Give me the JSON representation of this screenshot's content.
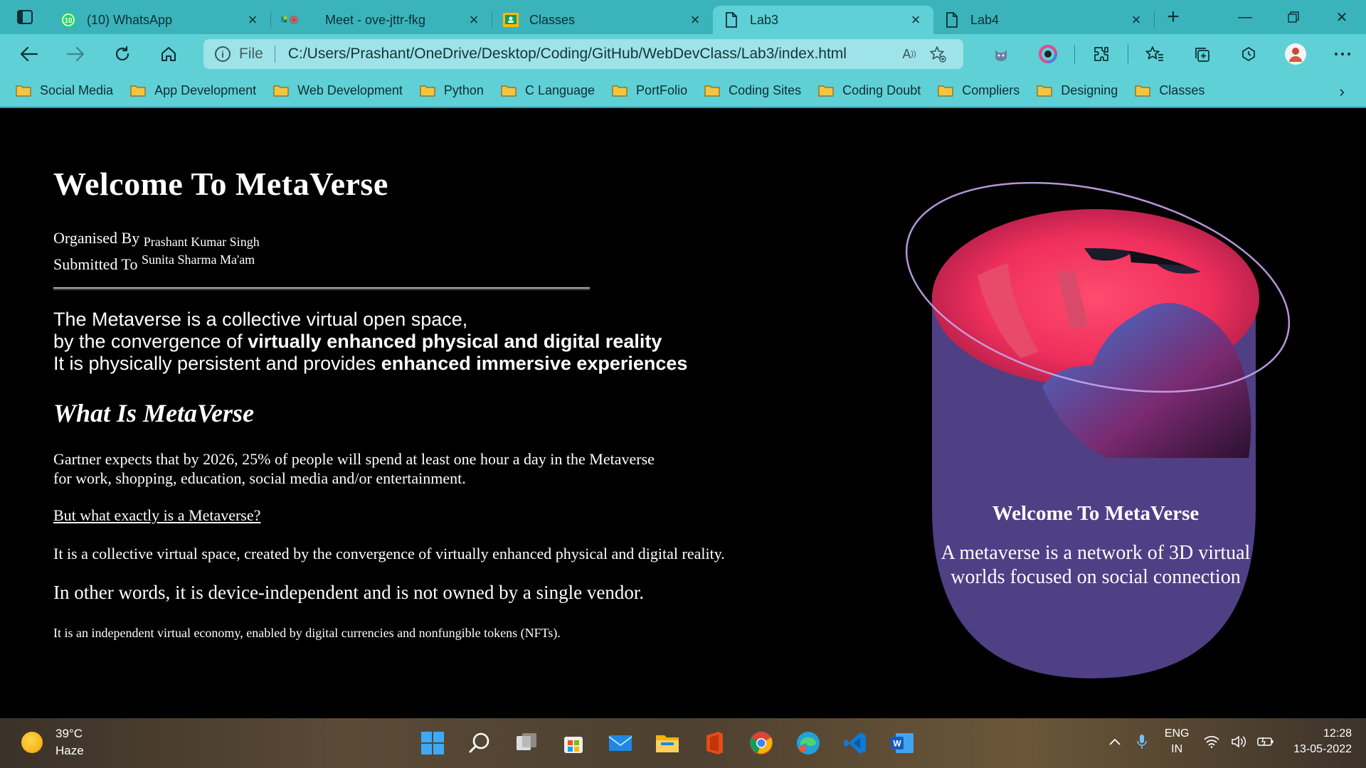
{
  "browser": {
    "tabs": [
      {
        "title": "(10) WhatsApp",
        "badge": "10",
        "icon": "whatsapp-icon"
      },
      {
        "title": "Meet - ove-jttr-fkg",
        "icon": "meet-icon"
      },
      {
        "title": "Classes",
        "icon": "classroom-icon"
      },
      {
        "title": "Lab3",
        "icon": "file-icon",
        "active": true
      },
      {
        "title": "Lab4",
        "icon": "file-icon"
      }
    ],
    "address": {
      "scheme": "File",
      "url": "C:/Users/Prashant/OneDrive/Desktop/Coding/GitHub/WebDevClass/Lab3/index.html"
    },
    "bookmarks": [
      "Social Media",
      "App Development",
      "Web Development",
      "Python",
      "C Language",
      "PortFolio",
      "Coding Sites",
      "Coding Doubt",
      "Compliers",
      "Designing",
      "Classes"
    ],
    "colors": {
      "tabbar": "#3bb3bb",
      "toolbar": "#5fd0d6",
      "addressbar": "#9ee3e7"
    }
  },
  "page": {
    "title": "Welcome To MetaVerse",
    "organised_label": "Organised By",
    "organised_name": "Prashant Kumar Singh",
    "submitted_label": "Submitted To",
    "submitted_name": "Sunita Sharma Ma'am",
    "intro": {
      "line1": "The Metaverse is a collective virtual open space,",
      "line2_pre": "by the convergence of ",
      "line2_bold": "virtually enhanced physical and digital reality",
      "line3_pre": "It is physically persistent and provides ",
      "line3_bold": "enhanced immersive experiences"
    },
    "what_heading": "What Is MetaVerse",
    "p1_line1": "Gartner expects that by 2026, 25% of people will spend at least one hour a day in the Metaverse",
    "p1_line2": "for work, shopping, education, social media and/or entertainment.",
    "link_text": "But what exactly is a Metaverse?",
    "p2": "It is a collective virtual space, created by the convergence of virtually enhanced physical and digital reality.",
    "p3": "In other words, it is device-independent and is not owned by a single vendor.",
    "p4": "It is an independent virtual economy, enabled by digital currencies and nonfungible tokens (NFTs).",
    "card": {
      "title": "Welcome To MetaVerse",
      "body": "A metaverse is a network of 3D virtual worlds focused on social connection",
      "colors": {
        "card": "#4f3f85",
        "glow": "#ff3f6a",
        "ring": "#b89be0"
      }
    }
  },
  "taskbar": {
    "weather_temp": "39°C",
    "weather_desc": "Haze",
    "apps": [
      "windows-start-icon",
      "search-icon",
      "task-view-icon",
      "store-icon",
      "mail-icon",
      "file-explorer-icon",
      "office-icon",
      "chrome-icon",
      "edge-icon",
      "vscode-icon",
      "word-icon"
    ],
    "lang_line1": "ENG",
    "lang_line2": "IN",
    "time": "12:28",
    "date": "13-05-2022"
  }
}
